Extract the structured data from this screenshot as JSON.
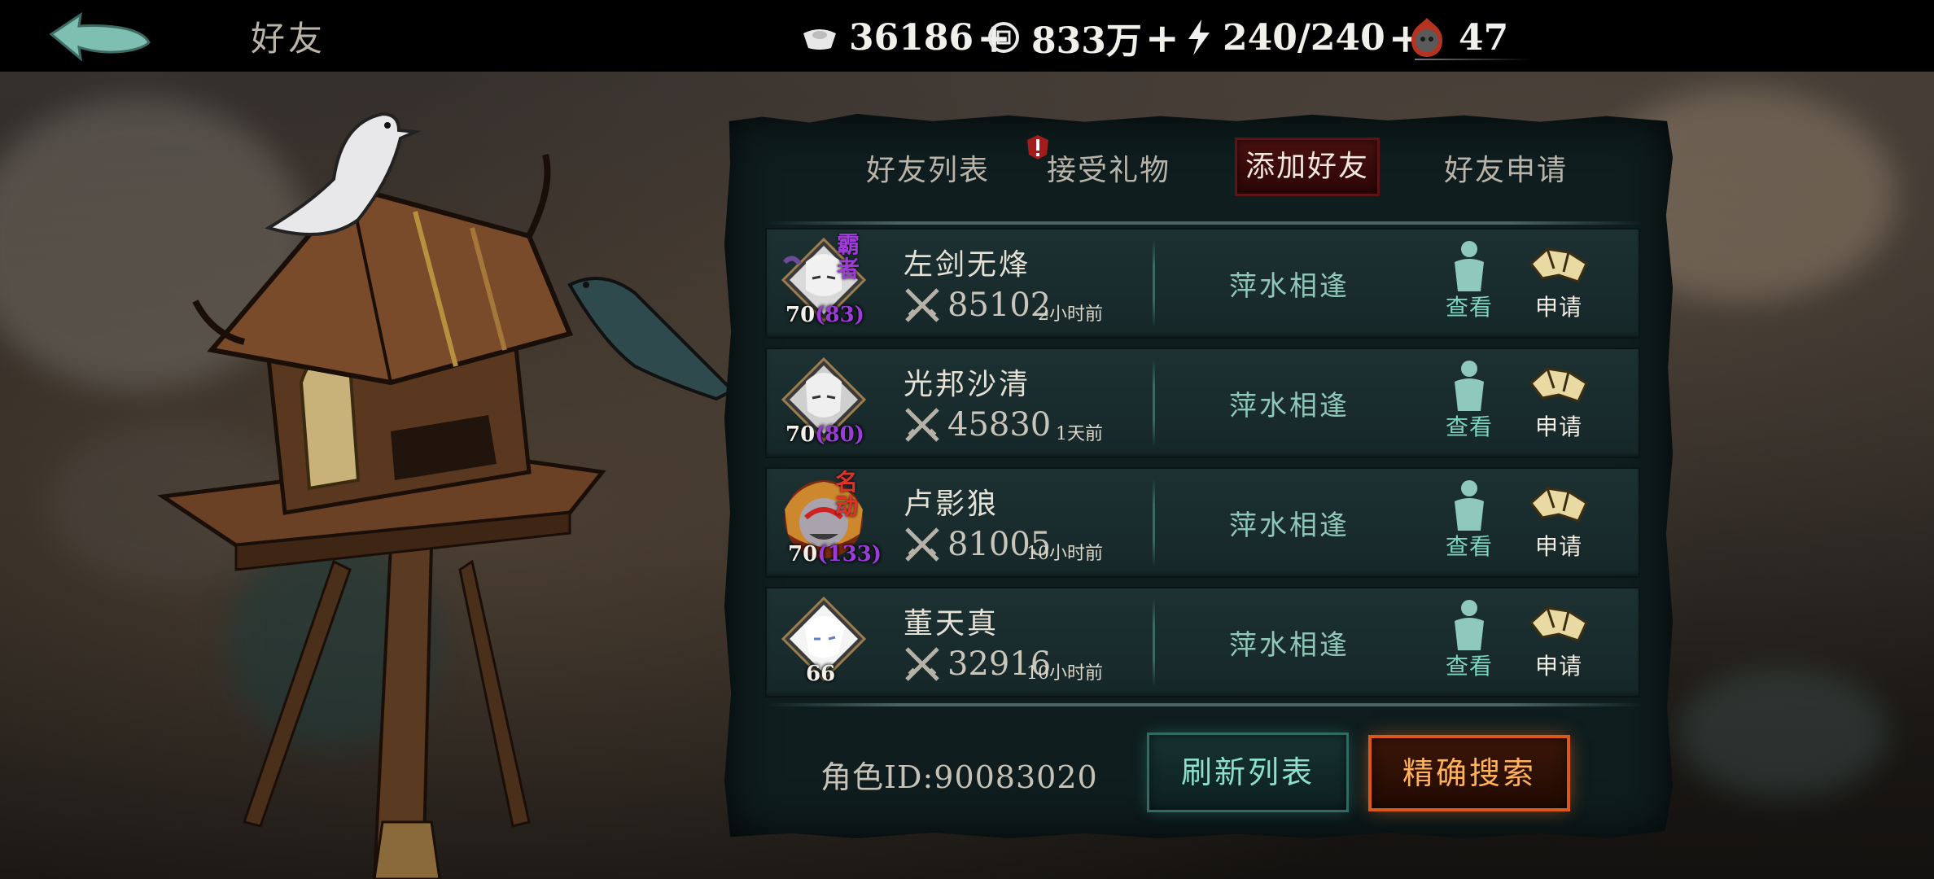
{
  "header": {
    "title": "好友",
    "resources": {
      "silver": "36186",
      "coins": "833万",
      "stamina": "240/240",
      "tokens": "47"
    },
    "plus": "+"
  },
  "tabs": [
    {
      "label": "好友列表",
      "active": false
    },
    {
      "label": "接受礼物",
      "active": false,
      "alert": true
    },
    {
      "label": "添加好友",
      "active": true
    },
    {
      "label": "好友申请",
      "active": false
    }
  ],
  "friends": [
    {
      "name": "左剑无烽",
      "level": "70",
      "level_extra": "(83)",
      "badge": "霸者",
      "power": "85102",
      "time": "2小时前",
      "relation": "萍水相逢"
    },
    {
      "name": "光邦沙清",
      "level": "70",
      "level_extra": "(80)",
      "badge": "",
      "power": "45830",
      "time": "1天前",
      "relation": "萍水相逢"
    },
    {
      "name": "卢影狼",
      "level": "70",
      "level_extra": "(133)",
      "badge": "名动",
      "power": "81005",
      "time": "10小时前",
      "relation": "萍水相逢"
    },
    {
      "name": "董天真",
      "level": "66",
      "level_extra": "",
      "badge": "",
      "power": "32916",
      "time": "10小时前",
      "relation": "萍水相逢"
    }
  ],
  "actions": {
    "view": "查看",
    "apply": "申请"
  },
  "footer": {
    "role_id": "角色ID:90083020",
    "refresh": "刷新列表",
    "search": "精确搜索"
  },
  "colors": {
    "accent_teal": "#8fc7b8",
    "accent_orange": "#ffb25a",
    "active_tab": "#4a1010",
    "level_purple": "#9b3bd9"
  }
}
